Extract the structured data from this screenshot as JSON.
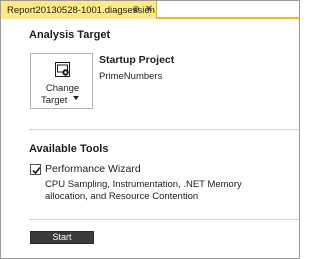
{
  "tab": {
    "title": "Report20130528-1001.diagsession",
    "pin_glyph": "⊕",
    "close_glyph": "✕"
  },
  "analysis_target": {
    "heading": "Analysis Target",
    "change_target": {
      "line1": "Change",
      "line2": "Target",
      "icon": "settings-target-icon"
    },
    "startup_label": "Startup Project",
    "project_name": "PrimeNumbers"
  },
  "available_tools": {
    "heading": "Available Tools",
    "tools": [
      {
        "name": "Performance Wizard",
        "checked": true,
        "description": "CPU Sampling, Instrumentation, .NET Memory allocation, and Resource Contention"
      }
    ]
  },
  "start_button": {
    "label": "Start"
  },
  "colors": {
    "tab_active": "#fde98a",
    "tab_underline": "#f0c000",
    "start_button_bg": "#3b3b3b"
  }
}
